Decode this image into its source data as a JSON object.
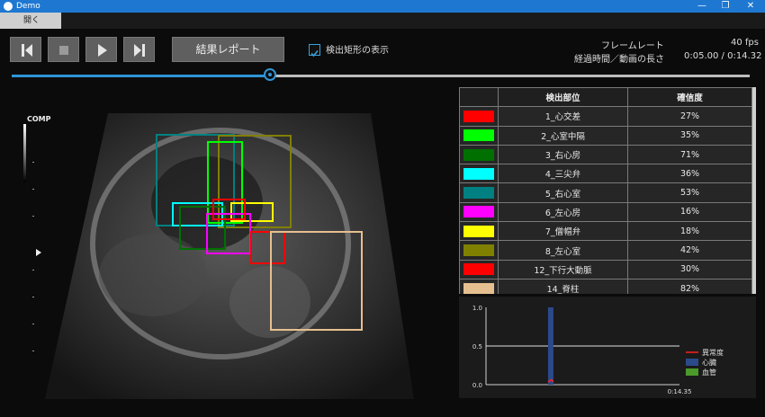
{
  "window": {
    "title": "Demo",
    "buttons": [
      "—",
      "❐",
      "✕"
    ]
  },
  "menu": {
    "open_label": "開く"
  },
  "controls": {
    "report_label": "結果レポート",
    "show_boxes_label": "検出矩形の表示",
    "show_boxes_checked": true
  },
  "status": {
    "framerate_label": "フレームレート",
    "framerate_value": "40 fps",
    "elapsed_label": "経過時間／動画の長さ",
    "elapsed_value": "0:05.00 / 0:14.32"
  },
  "playback": {
    "position_fraction": 0.35
  },
  "image": {
    "comp_label": "COMP"
  },
  "detection_table": {
    "headers": [
      "",
      "検出部位",
      "確信度"
    ],
    "rows": [
      {
        "color": "#ff0000",
        "part": "1_心交差",
        "confidence": "27%"
      },
      {
        "color": "#00ff00",
        "part": "2_心室中隔",
        "confidence": "35%"
      },
      {
        "color": "#007000",
        "part": "3_右心房",
        "confidence": "71%"
      },
      {
        "color": "#00ffff",
        "part": "4_三尖弁",
        "confidence": "36%"
      },
      {
        "color": "#008080",
        "part": "5_右心室",
        "confidence": "53%"
      },
      {
        "color": "#ff00ff",
        "part": "6_左心房",
        "confidence": "16%"
      },
      {
        "color": "#ffff00",
        "part": "7_僧帽弁",
        "confidence": "18%"
      },
      {
        "color": "#808000",
        "part": "8_左心室",
        "confidence": "42%"
      },
      {
        "color": "#ff0000",
        "part": "12_下行大動脈",
        "confidence": "30%"
      },
      {
        "color": "#e6bf90",
        "part": "14_脊柱",
        "confidence": "82%"
      }
    ]
  },
  "chart_data": {
    "type": "bar",
    "y_ticks": [
      "1.0",
      "0.5",
      "0.0"
    ],
    "ylim": [
      0,
      1
    ],
    "xlim": [
      0,
      14.35
    ],
    "x_end_label": "0:14.35",
    "threshold": 0.5,
    "series": [
      {
        "name": "異常度",
        "color": "#ff2020",
        "kind": "line",
        "points": [
          [
            4.6,
            0.0
          ],
          [
            4.85,
            0.03
          ],
          [
            5.0,
            0.0
          ]
        ]
      },
      {
        "name": "心臓",
        "color": "#2a4a8a",
        "kind": "bar",
        "x": [
          4.6,
          5.0
        ],
        "value": 1.0
      },
      {
        "name": "血管",
        "color": "#4a9a2a",
        "kind": "bar",
        "x": [],
        "value": 0
      }
    ]
  }
}
